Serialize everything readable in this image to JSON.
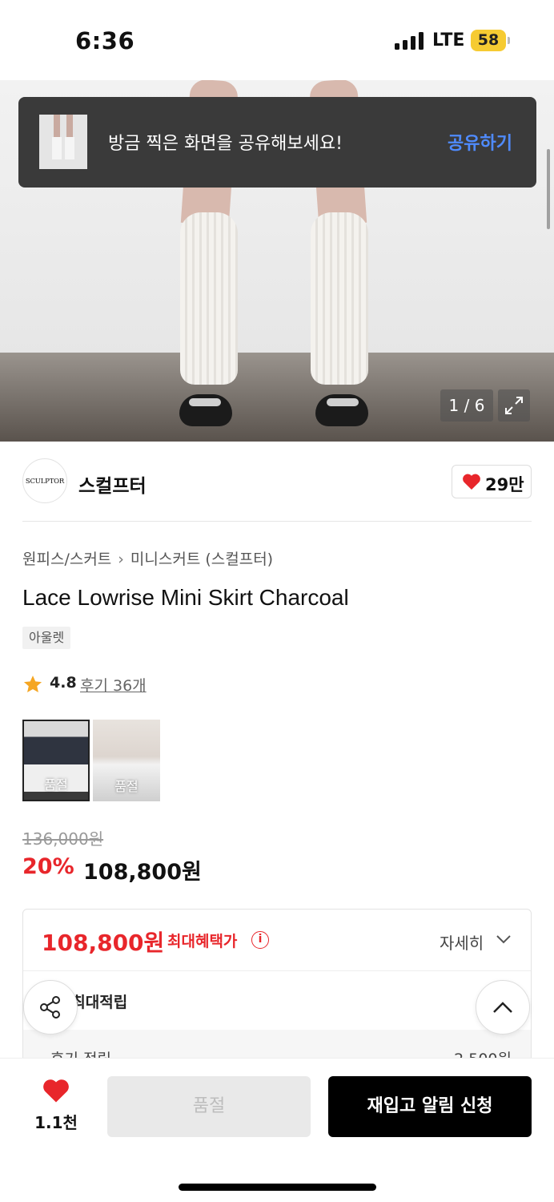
{
  "status_bar": {
    "time": "6:36",
    "network": "LTE",
    "battery": "58",
    "battery_color": "#f6cb32"
  },
  "gallery": {
    "counter": "1 / 6"
  },
  "toast": {
    "message": "방금 찍은 화면을 공유해보세요!",
    "action": "공유하기",
    "action_color": "#4f8bff"
  },
  "brand": {
    "logo_text": "SCULPTOR",
    "name": "스컬프터",
    "likes": "29만"
  },
  "product": {
    "breadcrumb": [
      "원피스/스커트",
      "미니스커트 (스컬프터)"
    ],
    "title": "Lace Lowrise Mini Skirt Charcoal",
    "tag": "아울렛",
    "rating": "4.8",
    "reviews": "후기 36개",
    "variants": [
      {
        "label": "품절",
        "selected": true
      },
      {
        "label": "품절",
        "selected": false
      }
    ],
    "original_price": "136,000원",
    "discount": "20%",
    "price": "108,800원"
  },
  "benefit": {
    "price": "108,800원",
    "label": "최대혜택가",
    "details": "자세히",
    "points": "0원 최대적립",
    "sub_label": "후기 적립",
    "sub_value": "2,500원"
  },
  "bottom_bar": {
    "wish_count": "1.1천",
    "soldout": "품절",
    "restock": "재입고 알림 신청"
  },
  "colors": {
    "accent_red": "#e8262b",
    "primary_black": "#000000"
  }
}
